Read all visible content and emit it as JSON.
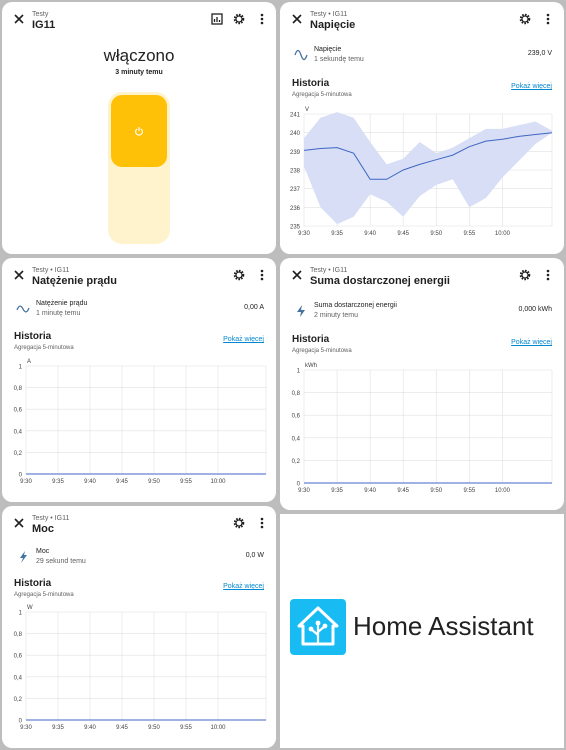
{
  "card1": {
    "crumb": "Testy",
    "title": "IG11",
    "state": "włączono",
    "changed": "3 minuty temu",
    "colors": {
      "on": "#ffc107",
      "track": "#fff3cd"
    }
  },
  "card2": {
    "crumb": "Testy • IG11",
    "title": "Napięcie",
    "entity": {
      "name": "Napięcie",
      "time": "1 sekundę temu",
      "value": "239,0 V"
    },
    "history": "Historia",
    "aggregation": "Agregacja 5-minutowa",
    "more": "Pokaż więcej",
    "chart_data": {
      "type": "line",
      "ylabel": "V",
      "ylim": [
        235,
        241
      ],
      "yticks": [
        "235",
        "236",
        "237",
        "238",
        "239",
        "240",
        "241"
      ],
      "xticks": [
        "9:30",
        "9:35",
        "9:40",
        "9:45",
        "9:50",
        "9:55",
        "10:00"
      ],
      "series": [
        {
          "x": [
            0,
            2.5,
            5,
            7.5,
            10,
            12.5,
            15,
            17.5,
            20,
            22.5,
            25,
            27.5,
            30,
            32.5,
            35,
            37.5
          ],
          "mean": [
            239.05,
            239.15,
            239.2,
            238.9,
            237.5,
            237.5,
            238.0,
            238.3,
            238.55,
            238.8,
            239.25,
            239.55,
            239.65,
            239.8,
            239.9,
            240.0
          ],
          "min": [
            238.2,
            236.0,
            235.1,
            235.5,
            236.7,
            236.3,
            235.5,
            236.6,
            237.2,
            237.5,
            236.0,
            236.5,
            237.6,
            238.5,
            239.4,
            240.0
          ],
          "max": [
            239.7,
            240.8,
            241.1,
            240.8,
            239.5,
            238.3,
            238.6,
            239.5,
            238.9,
            239.2,
            239.7,
            240.2,
            240.2,
            240.4,
            240.6,
            240.1
          ]
        }
      ],
      "colors": {
        "line": "#3f66c4",
        "band": "#d7def5"
      }
    }
  },
  "card3": {
    "crumb": "Testy • IG11",
    "title": "Natężenie prądu",
    "entity": {
      "name": "Natężenie prądu",
      "time": "1 minutę temu",
      "value": "0,00 A"
    },
    "history": "Historia",
    "aggregation": "Agregacja 5-minutowa",
    "more": "Pokaż więcej",
    "chart_data": {
      "type": "line",
      "ylabel": "A",
      "ylim": [
        0,
        1
      ],
      "yticks": [
        "0",
        "0,2",
        "0,4",
        "0,6",
        "0,8",
        "1"
      ],
      "xticks": [
        "9:30",
        "9:35",
        "9:40",
        "9:45",
        "9:50",
        "9:55",
        "10:00"
      ],
      "series": [
        {
          "x": [
            0,
            37.5
          ],
          "values": [
            0,
            0
          ]
        }
      ]
    }
  },
  "card4": {
    "crumb": "Testy • IG11",
    "title": "Suma dostarczonej energii",
    "entity": {
      "name": "Suma dostarczonej energii",
      "time": "2 minuty temu",
      "value": "0,000 kWh"
    },
    "history": "Historia",
    "aggregation": "Agregacja 5-minutowa",
    "more": "Pokaż więcej",
    "chart_data": {
      "type": "line",
      "ylabel": "kWh",
      "ylim": [
        0,
        1
      ],
      "yticks": [
        "0",
        "0,2",
        "0,4",
        "0,6",
        "0,8",
        "1"
      ],
      "xticks": [
        "9:30",
        "9:35",
        "9:40",
        "9:45",
        "9:50",
        "9:55",
        "10:00"
      ],
      "series": [
        {
          "x": [
            0,
            37.5
          ],
          "values": [
            0,
            0
          ]
        }
      ]
    }
  },
  "card5": {
    "crumb": "Testy • IG11",
    "title": "Moc",
    "entity": {
      "name": "Moc",
      "time": "29 sekund temu",
      "value": "0,0 W"
    },
    "history": "Historia",
    "aggregation": "Agregacja 5-minutowa",
    "more": "Pokaż więcej",
    "chart_data": {
      "type": "line",
      "ylabel": "W",
      "ylim": [
        0,
        1
      ],
      "yticks": [
        "0",
        "0,2",
        "0,4",
        "0,6",
        "0,8",
        "1"
      ],
      "xticks": [
        "9:30",
        "9:35",
        "9:40",
        "9:45",
        "9:50",
        "9:55",
        "10:00"
      ],
      "series": [
        {
          "x": [
            0,
            37.5
          ],
          "values": [
            0,
            0
          ]
        }
      ]
    }
  },
  "logo": {
    "text": "Home Assistant",
    "color": "#18bcf2"
  }
}
